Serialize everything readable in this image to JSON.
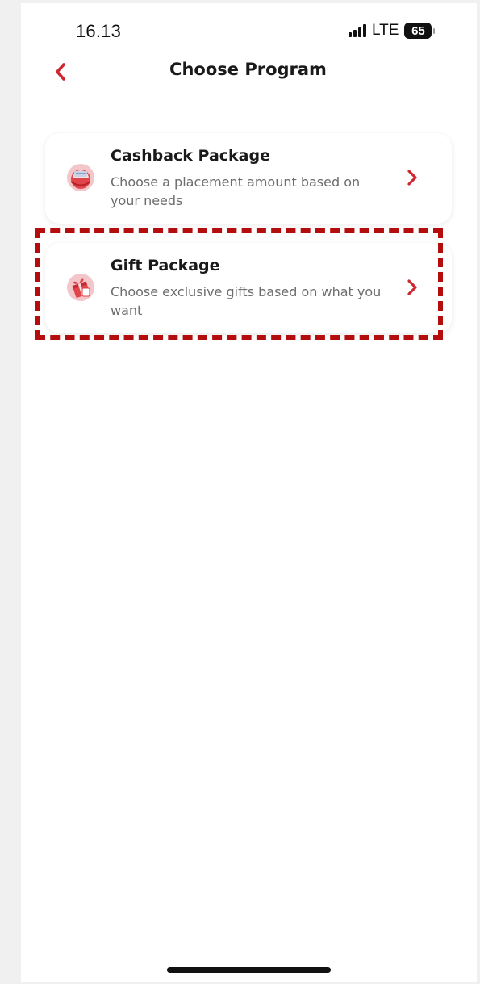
{
  "status_bar": {
    "time": "16.13",
    "network": "LTE",
    "battery": "65",
    "signal_bars": 4
  },
  "header": {
    "title": "Choose Program",
    "back_icon": "chevron-left-icon"
  },
  "programs": [
    {
      "title": "Cashback Package",
      "description": "Choose a placement amount based on your needs",
      "icon": "cashback-icon",
      "chevron": "chevron-right-icon"
    },
    {
      "title": "Gift Package",
      "description": "Choose exclusive gifts based on what you want",
      "icon": "gift-icon",
      "chevron": "chevron-right-icon",
      "highlighted": true
    }
  ],
  "colors": {
    "accent": "#d0262f",
    "highlight": "#b40d0d",
    "background": "#ffffff",
    "title_text": "#1a1a1a",
    "secondary_text": "#6d6d6d"
  }
}
